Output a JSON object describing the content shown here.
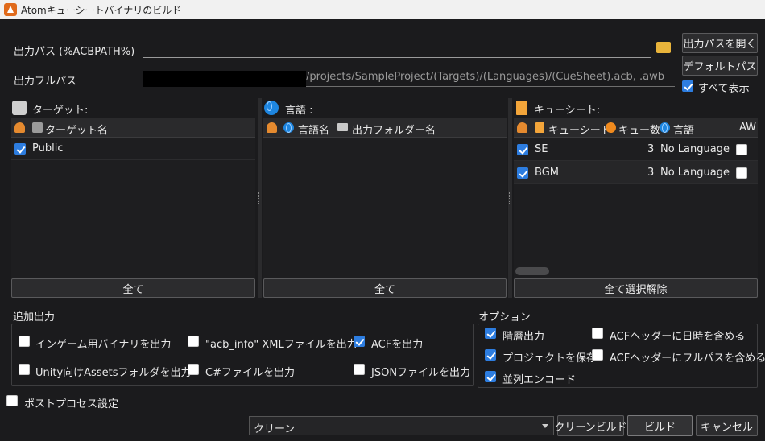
{
  "window": {
    "title": "Atomキューシートバイナリのビルド"
  },
  "output": {
    "path_label": "出力パス (%ACBPATH%)",
    "path_value": "",
    "fullpath_label": "出力フルパス",
    "fullpath_value": "/projects/SampleProject/(Targets)/(Languages)/(CueSheet).acb, .awb",
    "open_button": "出力パスを開く",
    "default_button": "デフォルトパス",
    "show_all": "すべて表示"
  },
  "targets": {
    "title": "ターゲット:",
    "col_name": "ターゲット名",
    "rows": [
      {
        "name": "Public",
        "checked": true
      }
    ],
    "all_button": "全て"
  },
  "languages": {
    "title": "言語 :",
    "col_lang": "言語名",
    "col_folder": "出力フォルダー名",
    "all_button": "全て"
  },
  "cuesheets": {
    "title": "キューシート:",
    "col_sheet": "キューシート",
    "col_count": "キュー数",
    "col_lang": "言語",
    "col_awb": "AW",
    "rows": [
      {
        "name": "SE",
        "count": "3",
        "lang": "No Language",
        "checked": true,
        "awb": false
      },
      {
        "name": "BGM",
        "count": "3",
        "lang": "No Language",
        "checked": true,
        "awb": false
      }
    ],
    "deselect_button": "全て選択解除"
  },
  "extra_output": {
    "title": "追加出力",
    "items": {
      "ingame": "インゲーム用バイナリを出力",
      "acb_info": "\"acb_info\" XMLファイルを出力",
      "acf": "ACFを出力",
      "unity": "Unity向けAssetsフォルダを出力",
      "csharp": "C#ファイルを出力",
      "json": "JSONファイルを出力"
    }
  },
  "options": {
    "title": "オプション",
    "items": {
      "hierarchy": "階層出力",
      "acf_date": "ACFヘッダーに日時を含める",
      "save_project": "プロジェクトを保存",
      "acf_fullpath": "ACFヘッダーにフルパスを含める",
      "parallel": "並列エンコード"
    }
  },
  "post_process": "ポストプロセス設定",
  "footer": {
    "combo_value": "クリーン",
    "clean_build": "クリーンビルド",
    "build": "ビルド",
    "cancel": "キャンセル"
  },
  "colors": {
    "background": "#1b1b1d",
    "check_blue": "#2d7de0",
    "accent_orange": "#e58a2f"
  }
}
